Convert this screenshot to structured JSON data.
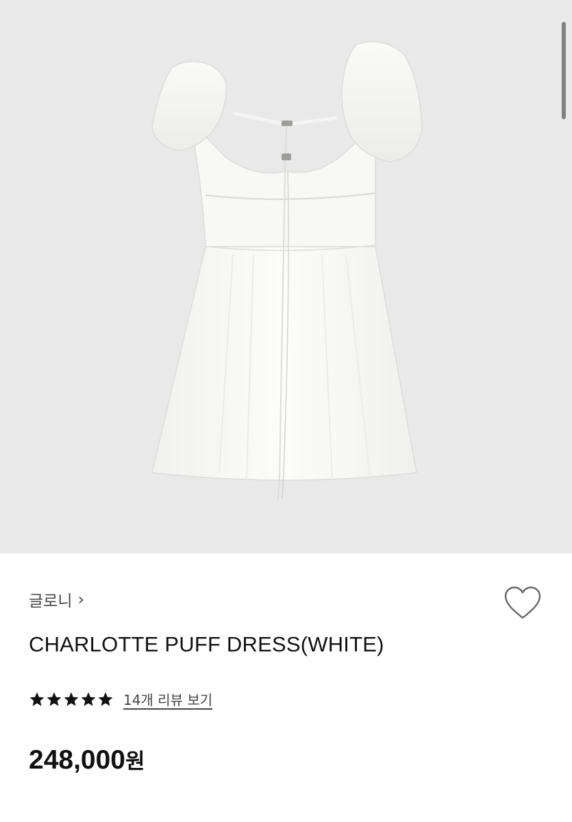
{
  "product": {
    "brand": "글로니",
    "brand_chevron": "›",
    "title": "CHARLOTTE PUFF DRESS(WHITE)",
    "rating_stars": 5,
    "review_link": "14개 리뷰 보기",
    "price_amount": "248,000",
    "price_unit": "원"
  },
  "icons": {
    "wishlist": "heart-outline-icon",
    "star": "star-icon"
  },
  "colors": {
    "hero_background": "#e9e9ea",
    "text_primary": "#111111",
    "text_secondary": "#444444"
  }
}
